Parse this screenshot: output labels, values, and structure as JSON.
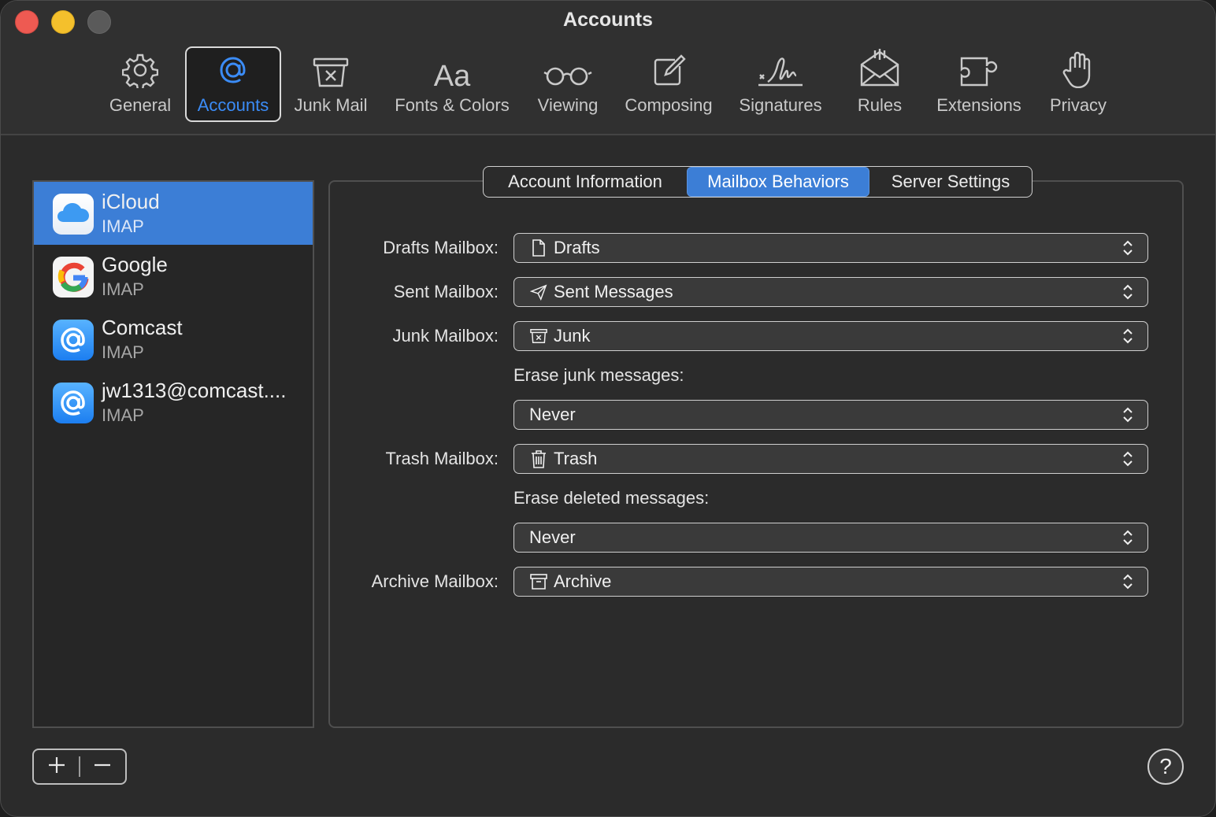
{
  "window": {
    "title": "Accounts"
  },
  "toolbar": {
    "items": [
      {
        "label": "General",
        "icon": "gear-icon"
      },
      {
        "label": "Accounts",
        "icon": "at-sign-icon",
        "selected": true
      },
      {
        "label": "Junk Mail",
        "icon": "junk-mail-icon"
      },
      {
        "label": "Fonts & Colors",
        "icon": "fonts-aa-icon"
      },
      {
        "label": "Viewing",
        "icon": "glasses-icon"
      },
      {
        "label": "Composing",
        "icon": "compose-pencil-icon"
      },
      {
        "label": "Signatures",
        "icon": "signature-icon"
      },
      {
        "label": "Rules",
        "icon": "rules-envelope-icon"
      },
      {
        "label": "Extensions",
        "icon": "puzzle-icon"
      },
      {
        "label": "Privacy",
        "icon": "hand-icon"
      }
    ]
  },
  "accounts": [
    {
      "name": "iCloud",
      "type": "IMAP",
      "icon": "icloud-icon",
      "selected": true
    },
    {
      "name": "Google",
      "type": "IMAP",
      "icon": "google-icon"
    },
    {
      "name": "Comcast",
      "type": "IMAP",
      "icon": "at-mail-icon"
    },
    {
      "name": "jw1313@comcast....",
      "type": "IMAP",
      "icon": "at-mail-icon"
    }
  ],
  "tabs": [
    {
      "label": "Account Information"
    },
    {
      "label": "Mailbox Behaviors",
      "selected": true
    },
    {
      "label": "Server Settings"
    }
  ],
  "behaviors": {
    "drafts": {
      "label": "Drafts Mailbox:",
      "value": "Drafts",
      "icon": "document-icon"
    },
    "sent": {
      "label": "Sent Mailbox:",
      "value": "Sent Messages",
      "icon": "paper-plane-icon"
    },
    "junk": {
      "label": "Junk Mailbox:",
      "value": "Junk",
      "icon": "junk-box-icon"
    },
    "erase_junk": {
      "label": "Erase junk messages:",
      "value": "Never"
    },
    "trash": {
      "label": "Trash Mailbox:",
      "value": "Trash",
      "icon": "trash-icon"
    },
    "erase_deleted": {
      "label": "Erase deleted messages:",
      "value": "Never"
    },
    "archive": {
      "label": "Archive Mailbox:",
      "value": "Archive",
      "icon": "archive-box-icon"
    }
  },
  "footer": {
    "add": "+",
    "remove": "−",
    "help": "?"
  },
  "colors": {
    "accent": "#3c7ed6",
    "selected_label": "#3b8cf7",
    "background": "#2b2b2b"
  }
}
